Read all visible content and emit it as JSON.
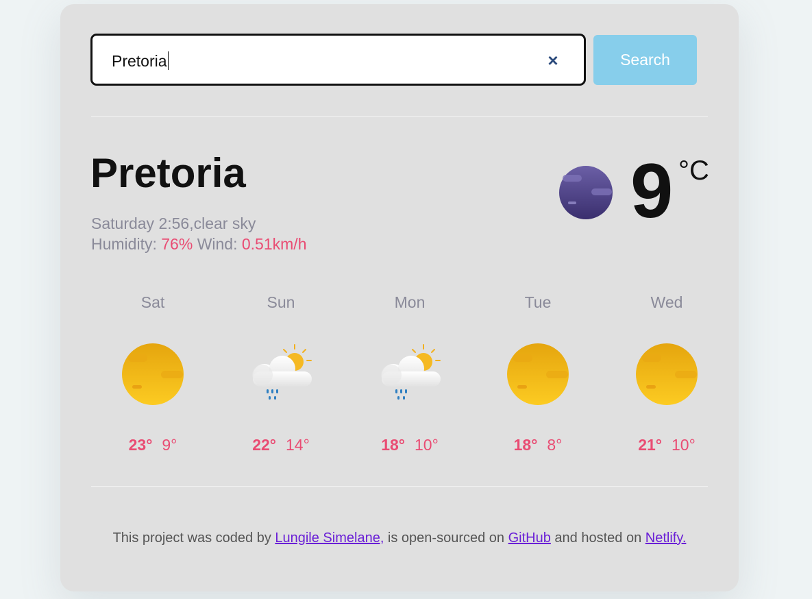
{
  "search": {
    "value": "Pretoria",
    "clear_icon": "×",
    "button_label": "Search"
  },
  "current": {
    "city": "Pretoria",
    "datetime_description": "Saturday 2:56,clear sky",
    "humidity_label": "Humidity:",
    "humidity_value": "76%",
    "wind_label": "Wind:",
    "wind_value": "0.51km/h",
    "temperature": "9",
    "unit": "°C",
    "icon": "moon-clear-night-icon"
  },
  "forecast": [
    {
      "day": "Sat",
      "max": "23°",
      "min": "9°",
      "icon": "sun-icon"
    },
    {
      "day": "Sun",
      "max": "22°",
      "min": "14°",
      "icon": "rain-sun-cloud-icon"
    },
    {
      "day": "Mon",
      "max": "18°",
      "min": "10°",
      "icon": "rain-sun-cloud-icon"
    },
    {
      "day": "Tue",
      "max": "18°",
      "min": "8°",
      "icon": "sun-icon"
    },
    {
      "day": "Wed",
      "max": "21°",
      "min": "10°",
      "icon": "sun-icon"
    }
  ],
  "footer": {
    "text_1": "This project was coded by ",
    "link_author": "Lungile Simelane,",
    "text_2": " is open-sourced on ",
    "link_github": "GitHub",
    "text_3": " and hosted on ",
    "link_netlify": "Netlify."
  },
  "colors": {
    "accent": "#e94c73",
    "button": "#87ceeb",
    "card": "#e0e0e0",
    "link": "#6a1fd6"
  }
}
